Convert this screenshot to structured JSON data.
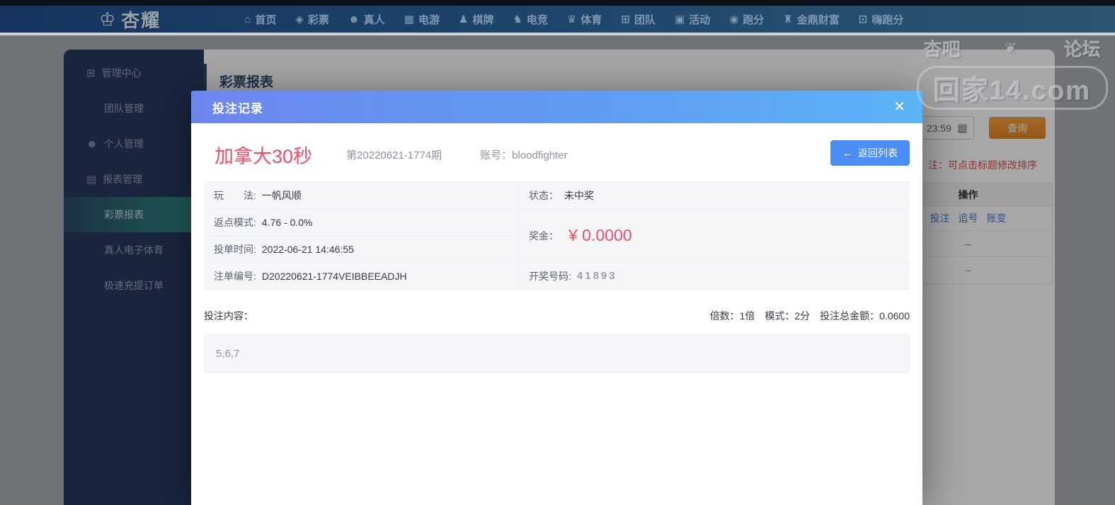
{
  "navbar": {
    "logo": {
      "glyph": "♔",
      "text": "杏耀"
    },
    "items": [
      {
        "name": "home",
        "glyph": "⌂",
        "label": "首页"
      },
      {
        "name": "lottery",
        "glyph": "◈",
        "label": "彩票"
      },
      {
        "name": "live",
        "glyph": "☻",
        "label": "真人"
      },
      {
        "name": "egame",
        "glyph": "▦",
        "label": "电游"
      },
      {
        "name": "chess",
        "glyph": "♟",
        "label": "棋牌"
      },
      {
        "name": "esports",
        "glyph": "♞",
        "label": "电竞"
      },
      {
        "name": "sports",
        "glyph": "♛",
        "label": "体育"
      },
      {
        "name": "team",
        "glyph": "⊞",
        "label": "团队"
      },
      {
        "name": "activity",
        "glyph": "▣",
        "label": "活动"
      },
      {
        "name": "paofen",
        "glyph": "◉",
        "label": "跑分"
      },
      {
        "name": "jinding-fortune",
        "glyph": "♜",
        "label": "金鼎财富"
      },
      {
        "name": "hi-paofen",
        "glyph": "⊡",
        "label": "嗨跑分"
      }
    ]
  },
  "sidebar": {
    "items": [
      {
        "name": "management-center",
        "glyph": "⊞",
        "label": "管理中心",
        "type": "parent"
      },
      {
        "name": "team-management",
        "label": "团队管理",
        "type": "child"
      },
      {
        "name": "personal-management",
        "glyph": "☻",
        "label": "个人管理",
        "type": "parent"
      },
      {
        "name": "report-management",
        "glyph": "▤",
        "label": "报表管理",
        "type": "parent"
      },
      {
        "name": "lottery-report",
        "label": "彩票报表",
        "type": "child",
        "active": true
      },
      {
        "name": "live-esports-report",
        "label": "真人电子体育",
        "type": "child"
      },
      {
        "name": "quick-deposit-orders",
        "label": "极速充提订单",
        "type": "child"
      }
    ]
  },
  "page": {
    "title": "彩票报表",
    "time_value": "23:59",
    "calendar_icon": "▦",
    "query_button": "查询",
    "sort_note": "注：可点击标题修改排序",
    "op_table": {
      "header": "操作",
      "links": [
        {
          "name": "bet",
          "label": "投注"
        },
        {
          "name": "chase",
          "label": "追号"
        },
        {
          "name": "ledger",
          "label": "账变"
        }
      ],
      "empty_rows": [
        {
          "label": "--"
        },
        {
          "label": "--"
        }
      ]
    }
  },
  "modal": {
    "title": "投注记录",
    "close_icon": "✕",
    "game_name": "加拿大30秒",
    "period": "第20220621-1774期",
    "account_label": "账号：",
    "account_value": "bloodfighter",
    "back_button": {
      "icon": "←",
      "label": "返回列表"
    },
    "fields": {
      "play_label": "玩　　法:",
      "play_value": "一帆风顺",
      "status_label": "状态：",
      "status_value": "未中奖",
      "rebate_label": "返点模式:",
      "rebate_value": "4.76 - 0.0%",
      "prize_label": "奖金：",
      "prize_value": "¥ 0.0000",
      "time_label": "投单时间:",
      "time_value": "2022-06-21 14:46:55",
      "order_label": "注单编号:",
      "order_value": "D20220621-1774VEIBBEEADJH",
      "draw_label": "开奖号码:",
      "draw_value": "41893"
    },
    "content_label": "投注内容：",
    "stats": {
      "multiple_label": "倍数：",
      "multiple_value": "1倍",
      "mode_label": "模式：",
      "mode_value": "2分",
      "total_label": "投注总金额：",
      "total_value": "0.0600"
    },
    "content_value": "5,6,7"
  },
  "watermark": {
    "left": "杏吧",
    "flourish": "❦",
    "right": "论坛",
    "domain": "回家14.com"
  },
  "colors": {
    "accent_red": "#ee5068",
    "accent_blue": "#4a8df5",
    "query_orange": "#e3841f",
    "sidebar_navy": "#263b5f",
    "active_teal": "#2f9187"
  }
}
